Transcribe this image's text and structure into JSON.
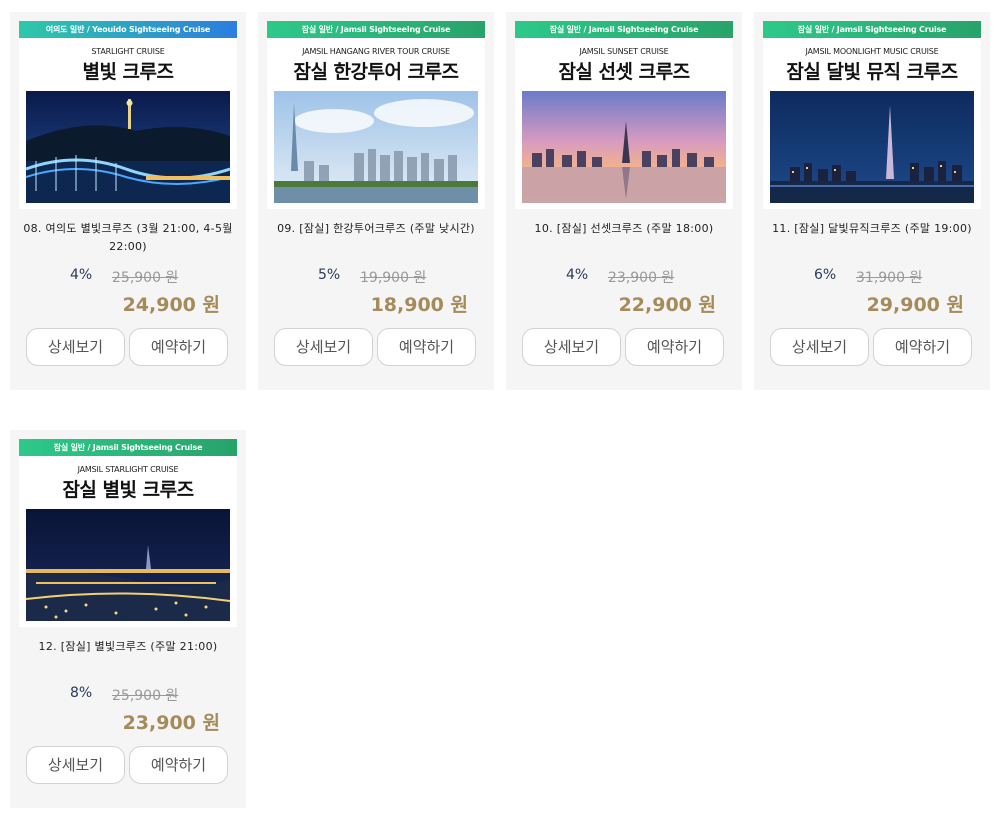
{
  "products": [
    {
      "banner": "여의도 일반 / Yeouido Sightseeing Cruise",
      "eng_title": "STARLIGHT CRUISE",
      "kor_title": "별빛 크루즈",
      "title": "08. 여의도 별빛크루즈 (3월 21:00, 4-5월 22:00)",
      "discount": "4%",
      "original_price": "25,900 원",
      "price": "24,900 원",
      "detail_label": "상세보기",
      "reserve_label": "예약하기"
    },
    {
      "banner": "잠실 일반 / Jamsil Sightseeing Cruise",
      "eng_title": "JAMSIL HANGANG RIVER TOUR CRUISE",
      "kor_title": "잠실 한강투어 크루즈",
      "title": "09. [잠실] 한강투어크루즈 (주말 낮시간)",
      "discount": "5%",
      "original_price": "19,900 원",
      "price": "18,900 원",
      "detail_label": "상세보기",
      "reserve_label": "예약하기"
    },
    {
      "banner": "잠실 일반 / Jamsil Sightseeing Cruise",
      "eng_title": "JAMSIL SUNSET CRUISE",
      "kor_title": "잠실 선셋 크루즈",
      "title": "10. [잠실] 선셋크루즈 (주말 18:00)",
      "discount": "4%",
      "original_price": "23,900 원",
      "price": "22,900 원",
      "detail_label": "상세보기",
      "reserve_label": "예약하기"
    },
    {
      "banner": "잠실 일반 / Jamsil Sightseeing Cruise",
      "eng_title": "JAMSIL MOONLIGHT MUSIC CRUISE",
      "kor_title": "잠실 달빛 뮤직 크루즈",
      "title": "11. [잠실] 달빛뮤직크루즈 (주말 19:00)",
      "discount": "6%",
      "original_price": "31,900 원",
      "price": "29,900 원",
      "detail_label": "상세보기",
      "reserve_label": "예약하기"
    },
    {
      "banner": "잠실 일반 / Jamsil Sightseeing Cruise",
      "eng_title": "JAMSIL STARLIGHT CRUISE",
      "kor_title": "잠실 별빛 크루즈",
      "title": "12. [잠실] 별빛크루즈 (주말 21:00)",
      "discount": "8%",
      "original_price": "25,900 원",
      "price": "23,900 원",
      "detail_label": "상세보기",
      "reserve_label": "예약하기"
    }
  ],
  "colors": {
    "card_bg": "#f5f5f5",
    "price": "#a58a5a",
    "discount": "#2a3a5a",
    "old_price": "#999999",
    "banner_blue_end": "#2b7de0",
    "banner_green": "#28a36a"
  }
}
